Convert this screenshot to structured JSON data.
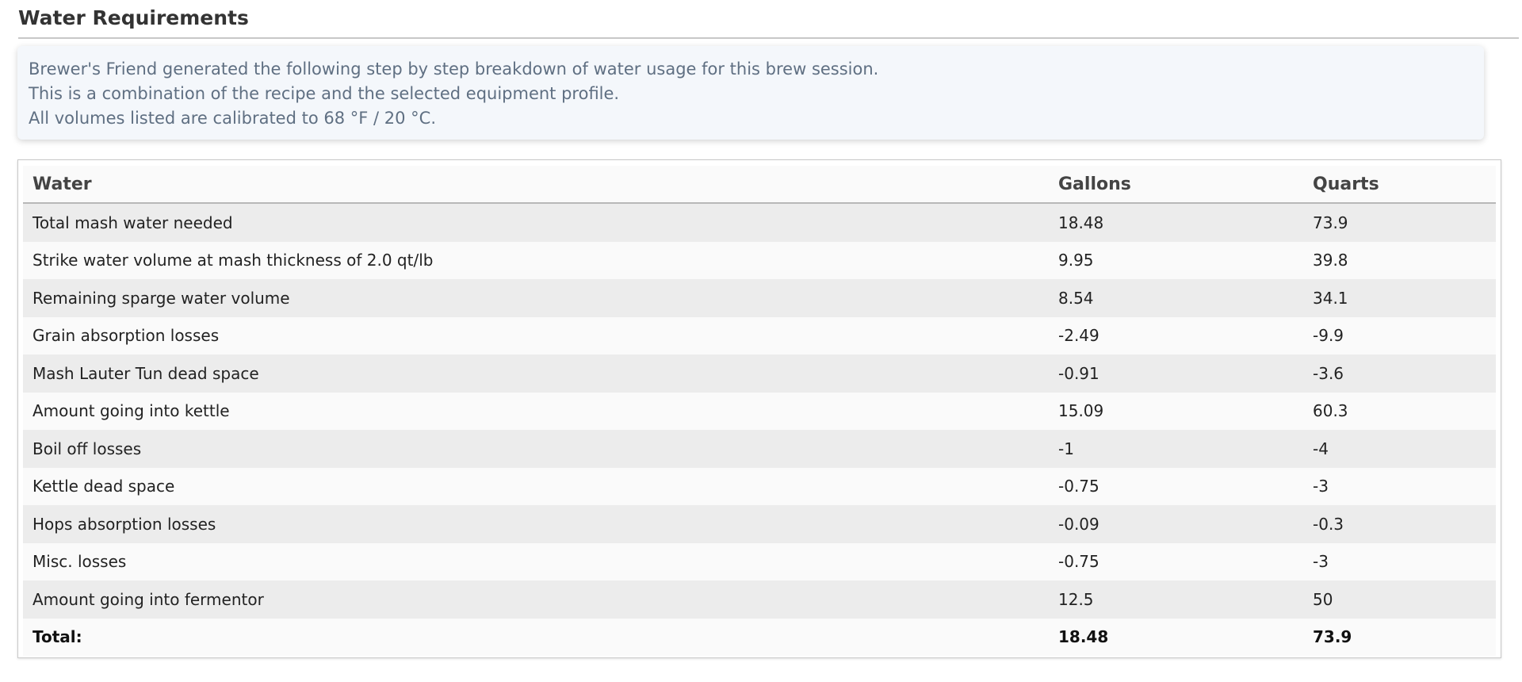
{
  "section": {
    "title": "Water Requirements"
  },
  "info": {
    "lines": [
      "Brewer's Friend generated the following step by step breakdown of water usage for this brew session.",
      "This is a combination of the recipe and the selected equipment profile.",
      "All volumes listed are calibrated to 68 °F / 20 °C."
    ]
  },
  "table": {
    "headers": [
      "Water",
      "Gallons",
      "Quarts"
    ],
    "rows": [
      {
        "name": "Total mash water needed",
        "gallons": "18.48",
        "quarts": "73.9"
      },
      {
        "name": "Strike water volume at mash thickness of 2.0 qt/lb",
        "gallons": "9.95",
        "quarts": "39.8"
      },
      {
        "name": "Remaining sparge water volume",
        "gallons": "8.54",
        "quarts": "34.1"
      },
      {
        "name": "Grain absorption losses",
        "gallons": "-2.49",
        "quarts": "-9.9"
      },
      {
        "name": "Mash Lauter Tun dead space",
        "gallons": "-0.91",
        "quarts": "-3.6"
      },
      {
        "name": "Amount going into kettle",
        "gallons": "15.09",
        "quarts": "60.3"
      },
      {
        "name": "Boil off losses",
        "gallons": "-1",
        "quarts": "-4"
      },
      {
        "name": "Kettle dead space",
        "gallons": "-0.75",
        "quarts": "-3"
      },
      {
        "name": "Hops absorption losses",
        "gallons": "-0.09",
        "quarts": "-0.3"
      },
      {
        "name": "Misc. losses",
        "gallons": "-0.75",
        "quarts": "-3"
      },
      {
        "name": "Amount going into fermentor",
        "gallons": "12.5",
        "quarts": "50"
      }
    ],
    "total": {
      "name": "Total:",
      "gallons": "18.48",
      "quarts": "73.9"
    }
  }
}
